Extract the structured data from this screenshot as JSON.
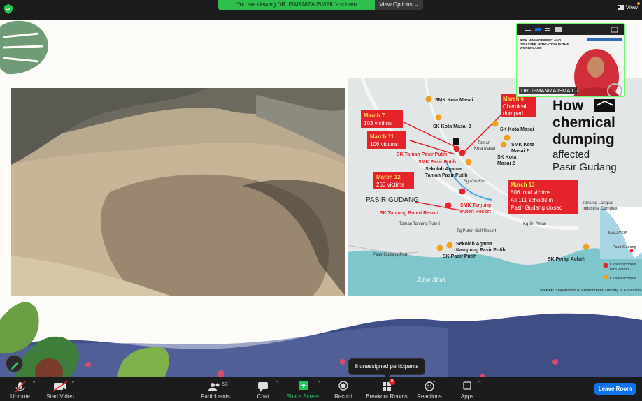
{
  "top_bar": {
    "sharing_banner": "You are viewing DR. ISMANIZA ISMAIL's screen",
    "view_options": "View Options",
    "view_button": "View"
  },
  "camera": {
    "name": "DR. ISMANIZA ISMAIL",
    "slide_title": "RISK MANAGEMENT AND DISASTER MITIGATION IN THE WORKPLACE"
  },
  "map": {
    "title_line1": "How",
    "title_line2": "chemical",
    "title_line3": "dumping",
    "title_line4": "affected",
    "title_line5": "Pasir Gudang",
    "callouts": {
      "march6": [
        "March 6",
        "Chemical",
        "dumped"
      ],
      "march7": [
        "March 7",
        "103 victims"
      ],
      "march11": [
        "March 11",
        "106 victims"
      ],
      "march12": [
        "March 12",
        "260 victims"
      ],
      "march13": [
        "March 13",
        "506 total victims",
        "All 111 schools in",
        "Pasir Gudang closed"
      ]
    },
    "places": {
      "smk_kota_masai": "SMK Kota Masai",
      "sk_kota_masai3": "SK Kota Masai 3",
      "sk_kota_masai": "SK Kota Masai",
      "taman_kota_masai": [
        "Taman",
        "Kota Masai"
      ],
      "smk_kota_masai2": [
        "SMK Kota",
        "Masai 2"
      ],
      "sk_kota_masai2": [
        "SK Kota",
        "Masai 2"
      ],
      "sk_taman_pasir_putih": "SK Taman Pasir Putih",
      "smk_pasir_putih": "SMK Pasir Putih",
      "sekolah_agama_taman": [
        "Sekolah Agama",
        "Taman Pasir Putih"
      ],
      "sg_kim_kim": "Sg Kim Kim",
      "tanjung_langsat": [
        "Tanjung Langsat",
        "Industrial Complex"
      ],
      "pasir_gudang": "PASIR GUDANG",
      "sk_tanjung_puteri": "SK Tanjung Puteri Resort",
      "smk_tanjung_puteri": [
        "SMK Tanjung",
        "Puteri Resort"
      ],
      "taman_tanjung_puteri": "Taman Tanjung Puteri",
      "tg_puteri_golf": "Tg Puteri Golf Resort",
      "kg_sri_aman": "Kg Sri Aman",
      "sekolah_agama_kampung": [
        "Sekolah Agama",
        "Kampung Pasir Putih"
      ],
      "sk_pasir_putih": "SK Pasir Putih",
      "pasir_gudang_port": "Pasir Gudang Port",
      "sk_perigi_acheh": "SK Perigi Acheh",
      "johor_strait": "Johor Strait",
      "malaysia": "MALAYSIA",
      "inset_pasir_gudang": "Pasir Gudang"
    },
    "legend": {
      "red": [
        "Closed schools",
        "with victims"
      ],
      "yellow": "Closed schools"
    },
    "source_label": "Source:",
    "source_text": "Department of Environment, Ministry of Education"
  },
  "tooltip": "8 unassigned participants",
  "toolbar": {
    "unmute": "Unmute",
    "start_video": "Start Video",
    "participants": "Participants",
    "participants_count": "53",
    "chat": "Chat",
    "share_screen": "Share Screen",
    "record": "Record",
    "breakout_rooms": "Breakout Rooms",
    "breakout_badge": "8",
    "reactions": "Reactions",
    "apps": "Apps",
    "leave_room": "Leave Room"
  },
  "colors": {
    "banner_green": "#2fbf4d",
    "leave_blue": "#0e72ed",
    "callout_red": "#e4232a",
    "share_green": "#22c55e"
  }
}
